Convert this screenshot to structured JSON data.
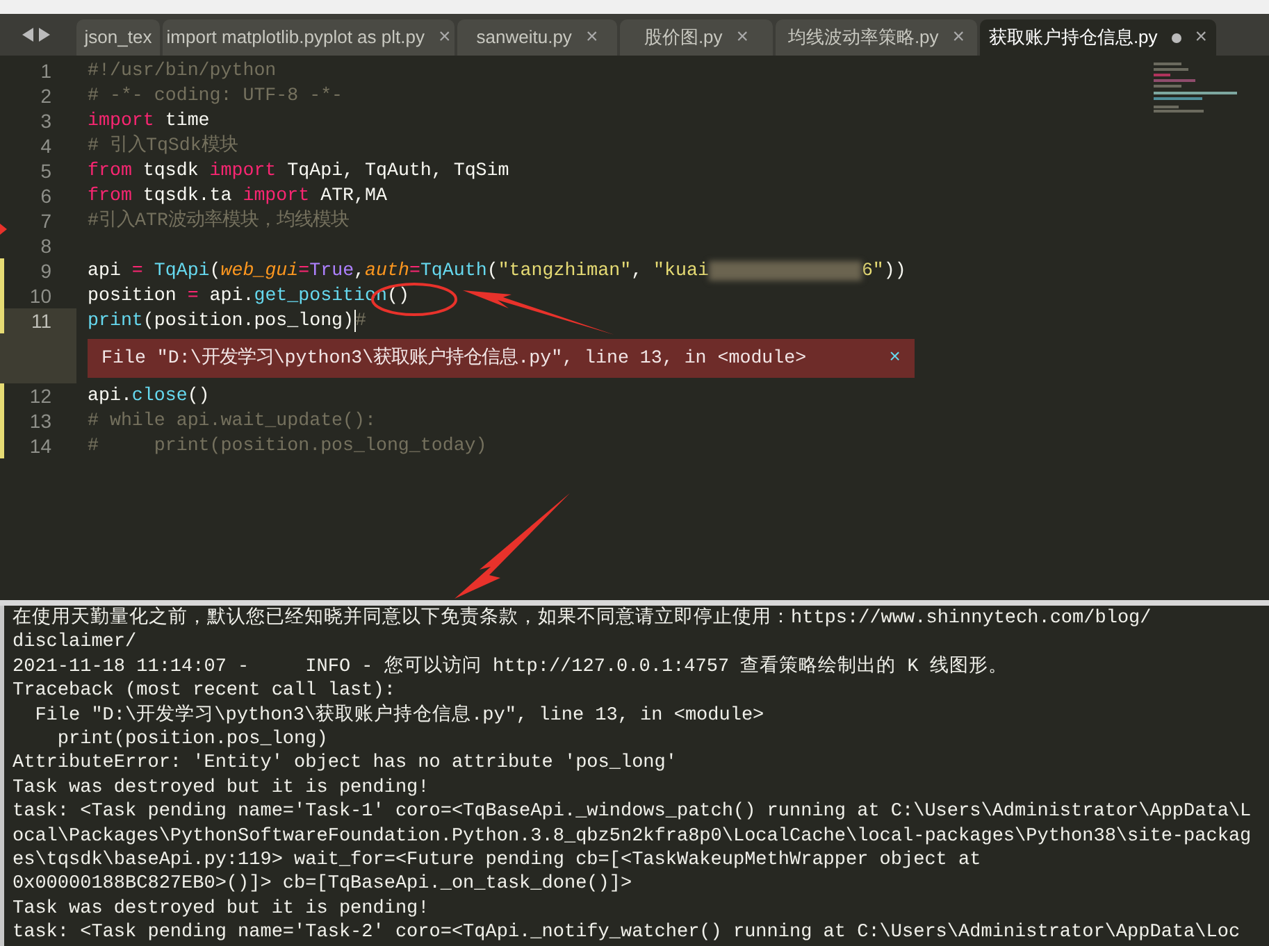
{
  "tabs": [
    {
      "label": "json_tex",
      "selected": false,
      "modified": false
    },
    {
      "label": "import matplotlib.pyplot as plt.py",
      "selected": false,
      "modified": false,
      "close": "×"
    },
    {
      "label": "sanweitu.py",
      "selected": false,
      "modified": false,
      "close": "×"
    },
    {
      "label": "股价图.py",
      "selected": false,
      "modified": false,
      "close": "×"
    },
    {
      "label": "均线波动率策略.py",
      "selected": false,
      "modified": false,
      "close": "×"
    },
    {
      "label": "获取账户持仓信息.py",
      "selected": true,
      "modified": true,
      "close": "×"
    }
  ],
  "editor": {
    "lines": [
      {
        "number": "1",
        "modified": false,
        "current": false,
        "marker": false,
        "tokens": [
          {
            "kind": "comment",
            "text": "#!/usr/bin/python"
          }
        ]
      },
      {
        "number": "2",
        "modified": false,
        "current": false,
        "marker": false,
        "tokens": [
          {
            "kind": "comment",
            "text": "# -*- coding: UTF-8 -*-"
          }
        ]
      },
      {
        "number": "3",
        "modified": false,
        "current": false,
        "marker": false,
        "tokens": [
          {
            "kind": "keyword",
            "text": "import"
          },
          {
            "kind": "plain",
            "text": " time"
          }
        ]
      },
      {
        "number": "4",
        "modified": false,
        "current": false,
        "marker": false,
        "tokens": [
          {
            "kind": "comment",
            "text": "# 引入TqSdk模块"
          }
        ]
      },
      {
        "number": "5",
        "modified": false,
        "current": false,
        "marker": false,
        "tokens": [
          {
            "kind": "keyword",
            "text": "from"
          },
          {
            "kind": "plain",
            "text": " tqsdk "
          },
          {
            "kind": "keyword",
            "text": "import"
          },
          {
            "kind": "plain",
            "text": " TqApi, TqAuth, TqSim"
          }
        ]
      },
      {
        "number": "6",
        "modified": false,
        "current": false,
        "marker": false,
        "tokens": [
          {
            "kind": "keyword",
            "text": "from"
          },
          {
            "kind": "plain",
            "text": " tqsdk.ta "
          },
          {
            "kind": "keyword",
            "text": "import"
          },
          {
            "kind": "plain",
            "text": " ATR,MA"
          }
        ]
      },
      {
        "number": "7",
        "modified": false,
        "current": false,
        "marker": true,
        "tokens": [
          {
            "kind": "comment",
            "text": "#引入ATR波动率模块，均线模块"
          }
        ]
      },
      {
        "number": "8",
        "modified": false,
        "current": false,
        "marker": false
      },
      {
        "number": "9",
        "modified": true,
        "current": false,
        "marker": false,
        "tokens": [
          {
            "kind": "plain",
            "text": "api "
          },
          {
            "kind": "keyword",
            "text": "="
          },
          {
            "kind": "func",
            "text": " TqApi"
          },
          {
            "kind": "plain",
            "text": "("
          },
          {
            "kind": "param",
            "text": "web_gui"
          },
          {
            "kind": "keyword",
            "text": "="
          },
          {
            "kind": "const",
            "text": "True"
          },
          {
            "kind": "plain",
            "text": ","
          },
          {
            "kind": "param",
            "text": "auth"
          },
          {
            "kind": "keyword",
            "text": "="
          },
          {
            "kind": "func",
            "text": "TqAuth"
          },
          {
            "kind": "plain",
            "text": "("
          },
          {
            "kind": "string",
            "text": "\"tangzhiman\""
          },
          {
            "kind": "plain",
            "text": ", "
          },
          {
            "kind": "string",
            "text": "\"kuai"
          },
          {
            "kind": "blur"
          },
          {
            "kind": "string",
            "text": "6\""
          },
          {
            "kind": "plain",
            "text": "))"
          }
        ]
      },
      {
        "number": "10",
        "modified": true,
        "current": false,
        "marker": false,
        "tokens": [
          {
            "kind": "plain",
            "text": "position "
          },
          {
            "kind": "keyword",
            "text": "="
          },
          {
            "kind": "plain",
            "text": " api."
          },
          {
            "kind": "func",
            "text": "get_position"
          },
          {
            "kind": "plain",
            "text": "()"
          }
        ]
      },
      {
        "number": "11",
        "modified": true,
        "current": true,
        "marker": false,
        "tokens": [
          {
            "kind": "func",
            "text": "print"
          },
          {
            "kind": "plain",
            "text": "(position.pos_long)"
          },
          {
            "kind": "cursor"
          },
          {
            "kind": "comment",
            "text": "#"
          }
        ],
        "error": {
          "text": "File \"D:\\开发学习\\python3\\获取账户持仓信息.py\", line 13, in <module>",
          "close": "×"
        }
      },
      {
        "number": "12",
        "modified": true,
        "current": false,
        "marker": false,
        "tokens": [
          {
            "kind": "plain",
            "text": "api."
          },
          {
            "kind": "func",
            "text": "close"
          },
          {
            "kind": "plain",
            "text": "()"
          }
        ]
      },
      {
        "number": "13",
        "modified": true,
        "current": false,
        "marker": false,
        "tokens": [
          {
            "kind": "comment",
            "text": "# while api.wait_update():"
          }
        ]
      },
      {
        "number": "14",
        "modified": true,
        "current": false,
        "marker": false,
        "tokens": [
          {
            "kind": "comment",
            "text": "#     print(position.pos_long_today)"
          }
        ]
      }
    ]
  },
  "console": {
    "lines": [
      "在使用天勤量化之前，默认您已经知晓并同意以下免责条款，如果不同意请立即停止使用：https://www.shinnytech.com/blog/",
      "disclaimer/",
      "2021-11-18 11:14:07 -     INFO - 您可以访问 http://127.0.0.1:4757 查看策略绘制出的 K 线图形。",
      "Traceback (most recent call last):",
      "  File \"D:\\开发学习\\python3\\获取账户持仓信息.py\", line 13, in <module>",
      "    print(position.pos_long)",
      "AttributeError: 'Entity' object has no attribute 'pos_long'",
      "Task was destroyed but it is pending!",
      "task: <Task pending name='Task-1' coro=<TqBaseApi._windows_patch() running at C:\\Users\\Administrator\\AppData\\L",
      "ocal\\Packages\\PythonSoftwareFoundation.Python.3.8_qbz5n2kfra8p0\\LocalCache\\local-packages\\Python38\\site-packag",
      "es\\tqsdk\\baseApi.py:119> wait_for=<Future pending cb=[<TaskWakeupMethWrapper object at",
      "0x00000188BC827EB0>()]> cb=[TqBaseApi._on_task_done()]>",
      "Task was destroyed but it is pending!",
      "task: <Task pending name='Task-2' coro=<TqApi._notify_watcher() running at C:\\Users\\Administrator\\AppData\\Loc"
    ]
  }
}
